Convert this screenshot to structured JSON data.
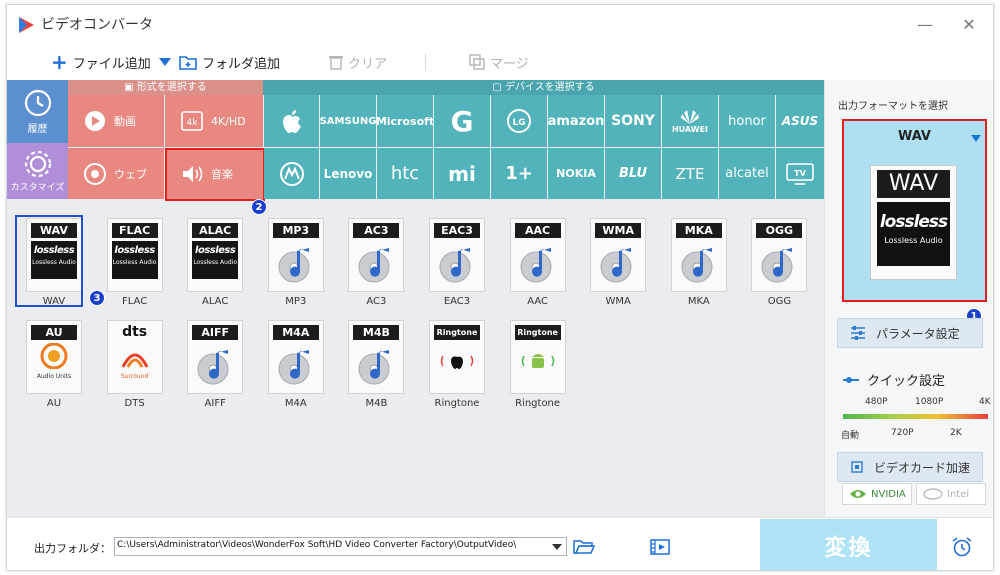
{
  "app": {
    "title": "ビデオコンバータ"
  },
  "window_controls": {
    "minimize": "—",
    "close": "✕"
  },
  "toolbar": {
    "add_files": "ファイル追加",
    "add_folder": "フォルダ追加",
    "clear": "クリア",
    "merge": "マージ"
  },
  "headers": {
    "format_select": "形式を選択する",
    "device_select": "デバイスを選択する"
  },
  "side_tabs": {
    "history": "履歴",
    "custom": "カスタマイズ"
  },
  "categories": {
    "video": "動画",
    "hd": "4K/HD",
    "web": "ウェブ",
    "music": "音楽"
  },
  "devices_row1": [
    "",
    "SAMSUNG",
    "Microsoft",
    "G",
    "LG",
    "amazon",
    "SONY",
    "HUAWEI",
    "honor",
    "ASUS"
  ],
  "devices_row2": [
    "",
    "Lenovo",
    "htc",
    "mi",
    "1+",
    "NOKIA",
    "BLU",
    "ZTE",
    "alcatel",
    "TV"
  ],
  "formats_row1": [
    {
      "label": "WAV",
      "name": "WAV",
      "sub": "Lossless Audio"
    },
    {
      "label": "FLAC",
      "name": "FLAC",
      "sub": "Lossless Audio"
    },
    {
      "label": "ALAC",
      "name": "ALAC",
      "sub": "Lossless Audio"
    },
    {
      "label": "MP3",
      "name": "MP3"
    },
    {
      "label": "AC3",
      "name": "AC3"
    },
    {
      "label": "EAC3",
      "name": "EAC3"
    },
    {
      "label": "AAC",
      "name": "AAC"
    },
    {
      "label": "WMA",
      "name": "WMA"
    },
    {
      "label": "MKA",
      "name": "MKA"
    },
    {
      "label": "OGG",
      "name": "OGG"
    }
  ],
  "formats_row2": [
    {
      "label": "AU",
      "name": "AU",
      "sub": "Audio Units"
    },
    {
      "label": "dts",
      "name": "DTS",
      "sub": "Surround"
    },
    {
      "label": "AIFF",
      "name": "AIFF"
    },
    {
      "label": "M4A",
      "name": "M4A"
    },
    {
      "label": "M4B",
      "name": "M4B"
    },
    {
      "label": "Ringtone",
      "name": "Ringtone"
    },
    {
      "label": "Ringtone",
      "name": "Ringtone"
    }
  ],
  "lossless_text": "lossless",
  "badges": {
    "one": "1",
    "two": "2",
    "three": "3"
  },
  "right": {
    "output_title": "出力フォーマットを選択",
    "selected_format": "WAV",
    "preview_label": "WAV",
    "preview_lossless": "lossless",
    "preview_sub": "Lossless Audio",
    "param_button": "パラメータ設定",
    "quick_title": "クイック設定",
    "quick_top": [
      "480P",
      "1080P",
      "4K"
    ],
    "quick_bottom": [
      "自動",
      "720P",
      "2K"
    ],
    "gpu_button": "ビデオカード加速",
    "nvidia": "NVIDIA",
    "intel": "Intel"
  },
  "footer": {
    "output_folder_label": "出力フォルダ：",
    "output_path": "C:\\Users\\Administrator\\Videos\\WonderFox Soft\\HD Video Converter Factory\\OutputVideo\\",
    "convert": "変換"
  },
  "colors": {
    "accent_red": "#e02020",
    "format_red": "#e88880",
    "device_teal": "#52b3bb",
    "side_blue": "#5b8fd0",
    "side_purple": "#b08fd8",
    "badge_blue": "#1a3fcf",
    "convert_bg": "#aee3f6"
  }
}
